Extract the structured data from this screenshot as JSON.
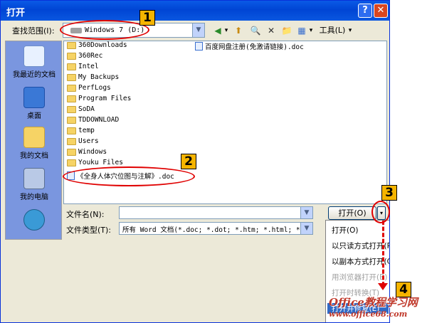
{
  "window": {
    "title": "打开",
    "help": "?",
    "close": "✕"
  },
  "lookin": {
    "label": "查找范围(I):",
    "value": "Windows 7 (D:)"
  },
  "toolbar": {
    "back": "◀",
    "back_arrow": "▾",
    "up": "⬆",
    "search": "🔍",
    "delete": "✕",
    "new_folder": "📁",
    "views": "▦",
    "views_arrow": "▾",
    "tools_label": "工具(L)",
    "tools_arrow": "▾"
  },
  "places": [
    {
      "name": "recent",
      "label": "我最近的文档",
      "color": "#e8f1ff"
    },
    {
      "name": "desktop",
      "label": "桌面",
      "color": "#3a78d6"
    },
    {
      "name": "documents",
      "label": "我的文档",
      "color": "#f6d365"
    },
    {
      "name": "computer",
      "label": "我的电脑",
      "color": "#b9c9e6"
    },
    {
      "name": "network",
      "label": "",
      "color": "#3a9ad6"
    }
  ],
  "files": {
    "folders": [
      "360Downloads",
      "360Rec",
      "Intel",
      "My Backups",
      "PerfLogs",
      "Program Files",
      "SoDA",
      "TDDOWNLOAD",
      "temp",
      "Users",
      "Windows",
      "Youku Files"
    ],
    "docs_col1": [
      "《全身人体穴位图与注解》.doc"
    ],
    "docs_col2": [
      "百度网盘注册(免激请链接).doc"
    ]
  },
  "filename": {
    "label": "文件名(N):",
    "value": ""
  },
  "filetype": {
    "label": "文件类型(T):",
    "value": "所有 Word 文档(*.doc; *.dot; *.htm; *.html; *."
  },
  "open_button": {
    "label": "打开(O)",
    "split": "▾"
  },
  "open_menu": [
    {
      "label": "打开(O)",
      "state": "normal"
    },
    {
      "label": "以只读方式打开(R)",
      "state": "normal"
    },
    {
      "label": "以副本方式打开(C)",
      "state": "normal"
    },
    {
      "label": "用浏览器打开(B)",
      "state": "disabled"
    },
    {
      "label": "打开时转换(T)",
      "state": "disabled"
    },
    {
      "label": "打开并修复(E)",
      "state": "selected"
    }
  ],
  "callouts": [
    "1",
    "2",
    "3",
    "4"
  ],
  "watermark": {
    "line1": "Office教程学习网",
    "line2": "www.office68.com"
  }
}
